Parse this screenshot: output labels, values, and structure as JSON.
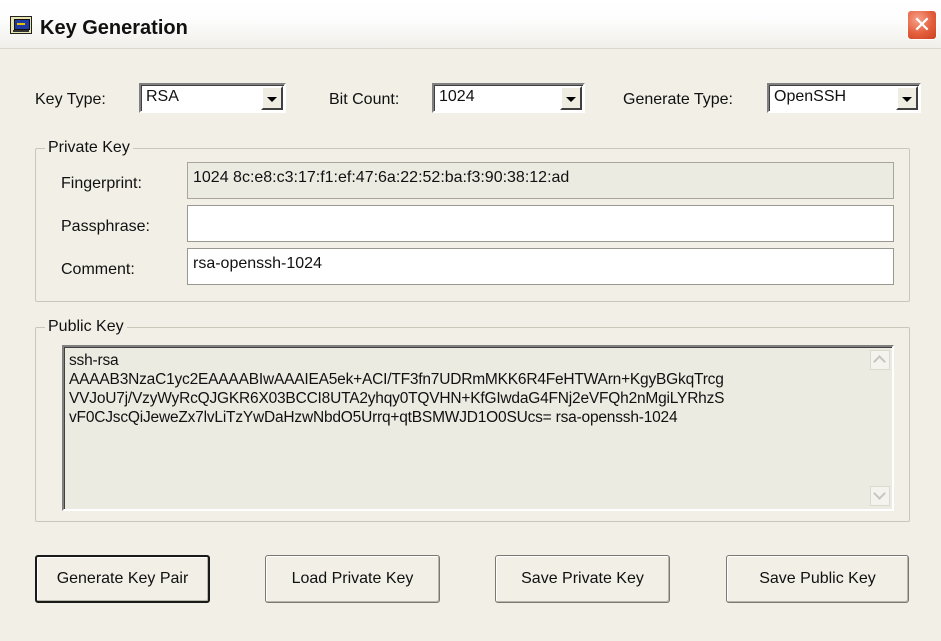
{
  "window": {
    "title": "Key Generation",
    "close_glyph": "✕"
  },
  "options": {
    "key_type": {
      "label": "Key Type:",
      "value": "RSA"
    },
    "bit_count": {
      "label": "Bit Count:",
      "value": "1024"
    },
    "generate_type": {
      "label": "Generate Type:",
      "value": "OpenSSH"
    }
  },
  "private_key": {
    "legend": "Private Key",
    "fingerprint": {
      "label": "Fingerprint:",
      "value": "1024 8c:e8:c3:17:f1:ef:47:6a:22:52:ba:f3:90:38:12:ad"
    },
    "passphrase": {
      "label": "Passphrase:",
      "value": ""
    },
    "comment": {
      "label": "Comment:",
      "value": "rsa-openssh-1024"
    }
  },
  "public_key": {
    "legend": "Public Key",
    "value": "ssh-rsa\nAAAAB3NzaC1yc2EAAAABIwAAAIEA5ek+ACI/TF3fn7UDRmMKK6R4FeHTWArn+KgyBGkqTrcg\nVVJoU7j/VzyWyRcQJGKR6X03BCCI8UTA2yhqy0TQVHN+KfGIwdaG4FNj2eVFQh2nMgiLYRhzS\nvF0CJscQiJeweZx7lvLiTzYwDaHzwNbdO5Urrq+qtBSMWJD1O0SUcs= rsa-openssh-1024"
  },
  "buttons": {
    "generate": "Generate Key Pair",
    "load_private": "Load Private Key",
    "save_private": "Save Private Key",
    "save_public": "Save Public Key"
  },
  "colors": {
    "window_bg": "#f1efe6",
    "close_red": "#e35d3c"
  }
}
